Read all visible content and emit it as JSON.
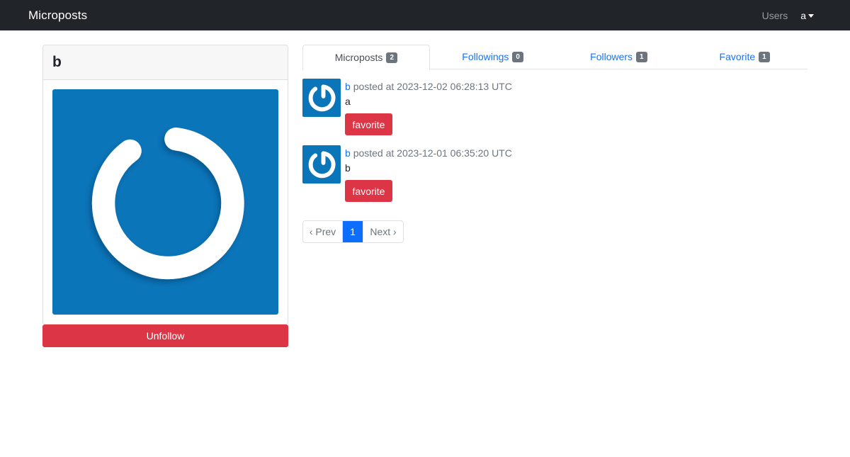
{
  "navbar": {
    "brand": "Microposts",
    "users_link": "Users",
    "current_user": "a"
  },
  "profile": {
    "name": "b",
    "unfollow_label": "Unfollow",
    "avatar_color": "#0b75b9"
  },
  "tabs": [
    {
      "label": "Microposts",
      "count": "2",
      "active": true
    },
    {
      "label": "Followings",
      "count": "0",
      "active": false
    },
    {
      "label": "Followers",
      "count": "1",
      "active": false
    },
    {
      "label": "Favorite",
      "count": "1",
      "active": false
    }
  ],
  "posts": [
    {
      "user": "b",
      "meta": "posted at 2023-12-02 06:28:13 UTC",
      "content": "a",
      "button": "favorite"
    },
    {
      "user": "b",
      "meta": "posted at 2023-12-01 06:35:20 UTC",
      "content": "b",
      "button": "favorite"
    }
  ],
  "pagination": {
    "prev": "‹ Prev",
    "current": "1",
    "next": "Next ›"
  },
  "colors": {
    "danger": "#dc3545",
    "primary": "#0d6efd",
    "link": "#1d72f2",
    "navbar": "#212529"
  }
}
